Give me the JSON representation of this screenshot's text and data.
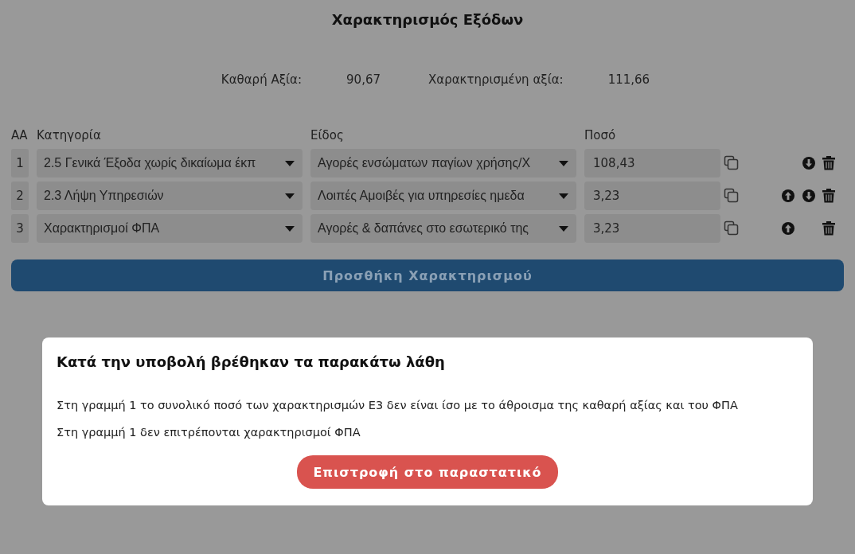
{
  "title": "Χαρακτηρισμός Εξόδων",
  "summary": [
    {
      "label": "Καθαρή Αξία:",
      "value": "90,67"
    },
    {
      "label": "Χαρακτηρισμένη αξία:",
      "value": "111,66"
    }
  ],
  "columns": [
    "ΑΑ",
    "Κατηγορία",
    "Είδος",
    "Ποσό"
  ],
  "rows": [
    {
      "index": "1",
      "category": "2.5 Γενικά Έξοδα χωρίς δικαίωμα έκπ",
      "type": "Αγορές ενσώματων παγίων χρήσης/Χ",
      "amount": "108,43",
      "can_move_up": false,
      "can_move_down": true
    },
    {
      "index": "2",
      "category": "2.3 Λήψη Υπηρεσιών",
      "type": "Λοιπές Αμοιβές για υπηρεσίες ημεδα",
      "amount": "3,23",
      "can_move_up": true,
      "can_move_down": true
    },
    {
      "index": "3",
      "category": "Χαρακτηρισμοί ΦΠΑ",
      "type": "Αγορές & δαπάνες στο εσωτερικό της",
      "amount": "3,23",
      "can_move_up": true,
      "can_move_down": false
    }
  ],
  "add_button": "Προσθήκη Χαρακτηρισμού",
  "dialog": {
    "title": "Κατά την υποβολή βρέθηκαν τα παρακάτω λάθη",
    "errors": [
      "Στη γραμμή 1 το συνολικό ποσό των χαρακτηρισμών Ε3 δεν είναι ίσο με το άθροισμα της καθαρή αξίας και του ΦΠΑ",
      "Στη γραμμή 1 δεν επιτρέπονται χαρακτηρισμοί ΦΠΑ"
    ],
    "button": "Επιστροφή στο παραστατικό"
  }
}
